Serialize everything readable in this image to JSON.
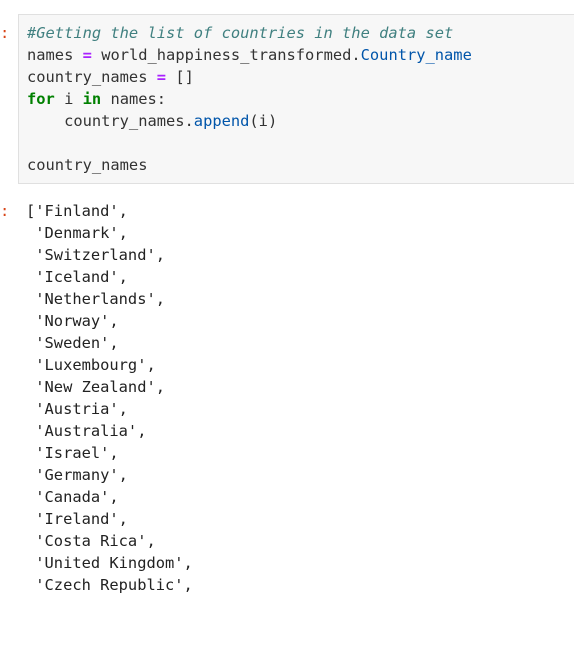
{
  "cell": {
    "input_prompt": ":",
    "output_prompt": ":",
    "code": {
      "comment": "#Getting the list of countries in the data set",
      "line2_var": "names",
      "line2_eq": "=",
      "line2_obj": "world_happiness_transformed.",
      "line2_attr": "Country_name",
      "line3_var": "country_names",
      "line3_eq": "=",
      "line3_val": "[]",
      "line4_kw_for": "for",
      "line4_var": " i ",
      "line4_kw_in": "in",
      "line4_rest": " names:",
      "line5_indent": "    country_names.",
      "line5_attr": "append",
      "line5_args": "(i)",
      "line7": "country_names"
    },
    "output_lines": [
      "['Finland',",
      " 'Denmark',",
      " 'Switzerland',",
      " 'Iceland',",
      " 'Netherlands',",
      " 'Norway',",
      " 'Sweden',",
      " 'Luxembourg',",
      " 'New Zealand',",
      " 'Austria',",
      " 'Australia',",
      " 'Israel',",
      " 'Germany',",
      " 'Canada',",
      " 'Ireland',",
      " 'Costa Rica',",
      " 'United Kingdom',",
      " 'Czech Republic',"
    ]
  }
}
